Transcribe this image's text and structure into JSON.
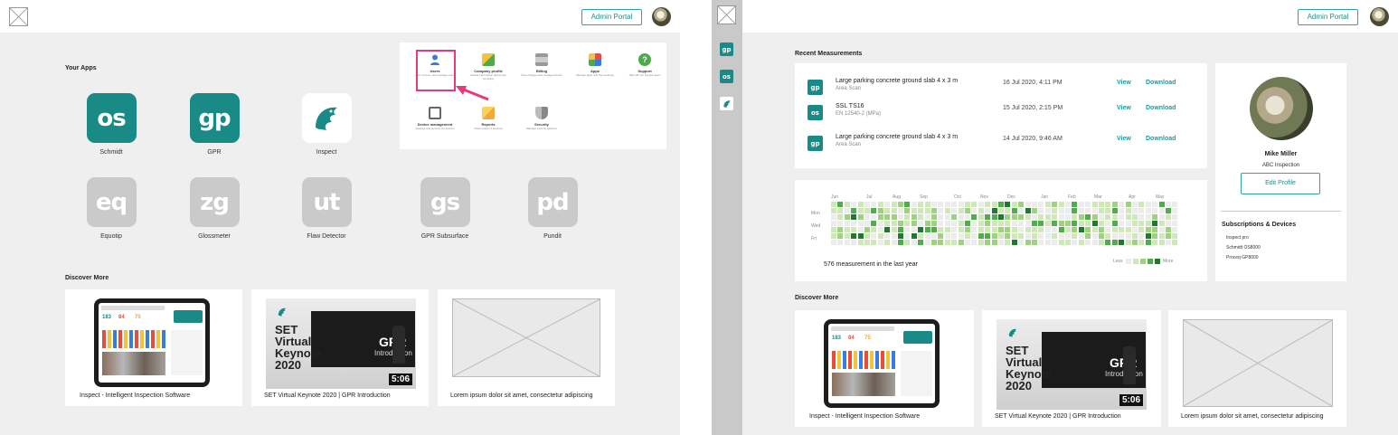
{
  "left": {
    "admin_button": "Admin Portal",
    "your_apps_title": "Your Apps",
    "apps": [
      {
        "code": "os",
        "label": "Schmidt",
        "enabled": true
      },
      {
        "code": "gp",
        "label": "GPR",
        "enabled": true
      },
      {
        "code": "",
        "label": "Inspect",
        "enabled": true
      },
      {
        "code": "eq",
        "label": "Equotip",
        "enabled": false
      },
      {
        "code": "zg",
        "label": "Glossmeter",
        "enabled": false
      },
      {
        "code": "ut",
        "label": "Flaw Detector",
        "enabled": false
      },
      {
        "code": "gs",
        "label": "GPR Subsurface",
        "enabled": false
      },
      {
        "code": "pd",
        "label": "Pundit",
        "enabled": false
      }
    ],
    "panel": [
      {
        "title": "Users",
        "desc": "Add, remove, and manage users"
      },
      {
        "title": "Company profile",
        "desc": "Update information about your company"
      },
      {
        "title": "Billing",
        "desc": "View charges and manage license"
      },
      {
        "title": "Apps",
        "desc": "Manage apps and their settings"
      },
      {
        "title": "Support",
        "desc": "Talk with our support team"
      },
      {
        "title": "Device management",
        "desc": "Settings and security for devices"
      },
      {
        "title": "Reports",
        "desc": "Track usage of services"
      },
      {
        "title": "Security",
        "desc": "Manage security features"
      }
    ],
    "discover_title": "Discover More",
    "cards": [
      {
        "caption": "Inspect - Intelligent Inspection Software"
      },
      {
        "caption": "SET Virtual Keynote 2020 | GPR Introduction"
      },
      {
        "caption": "Lorem ipsum dolor sit amet, consectetur adipiscing"
      }
    ]
  },
  "video": {
    "title_line1": "SET",
    "title_line2": "Virtual",
    "title_line3": "Keynote",
    "title_line4": "2020",
    "screen_title": "GPR",
    "screen_sub": "Introduction",
    "duration": "5:06"
  },
  "right": {
    "admin_button": "Admin Portal",
    "sidebar": [
      {
        "code": "gp"
      },
      {
        "code": "os"
      },
      {
        "code": ""
      }
    ],
    "recent_title": "Recent Measurements",
    "measurements": [
      {
        "code": "gp",
        "name": "Large parking concrete ground slab 4 x 3 m",
        "sub": "Area Scan",
        "date": "16 Jul 2020, 4:11 PM",
        "view": "View",
        "download": "Download"
      },
      {
        "code": "os",
        "name": "SSL TS16",
        "sub": "EN 12540-2 (MPa)",
        "date": "15 Jul 2020, 2:15 PM",
        "view": "View",
        "download": "Download"
      },
      {
        "code": "gp",
        "name": "Large parking concrete ground slab 4 x 3 m",
        "sub": "Area Scan",
        "date": "14 Jul 2020, 9:46 AM",
        "view": "View",
        "download": "Download"
      }
    ],
    "heatmap": {
      "months": [
        "Jun",
        "Jul",
        "Aug",
        "Sep",
        "Oct",
        "Nov",
        "Dec",
        "Jan",
        "Feb",
        "Mar",
        "Apr",
        "May"
      ],
      "days": [
        "Mon",
        "Wed",
        "Fri"
      ],
      "summary": "576 measurement in the last year",
      "less": "Less",
      "more": "More",
      "colors": [
        "#ececec",
        "#cfe8b8",
        "#9fd27f",
        "#4fae4a",
        "#1f7a2e"
      ]
    },
    "profile": {
      "name": "Mike Miller",
      "company": "ABC Inspection",
      "edit_button": "Edit Profile",
      "subs_title": "Subscriptions & Devices",
      "subs": [
        "Inspect pro",
        "Schmidt OS8000",
        "Proceq GP8000"
      ]
    },
    "discover_title": "Discover More",
    "cards": [
      {
        "caption": "Inspect - Intelligent Inspection Software"
      },
      {
        "caption": "SET Virtual Keynote 2020 | GPR Introduction"
      },
      {
        "caption": "Lorem ipsum dolor sit amet, consectetur adipiscing"
      }
    ]
  }
}
